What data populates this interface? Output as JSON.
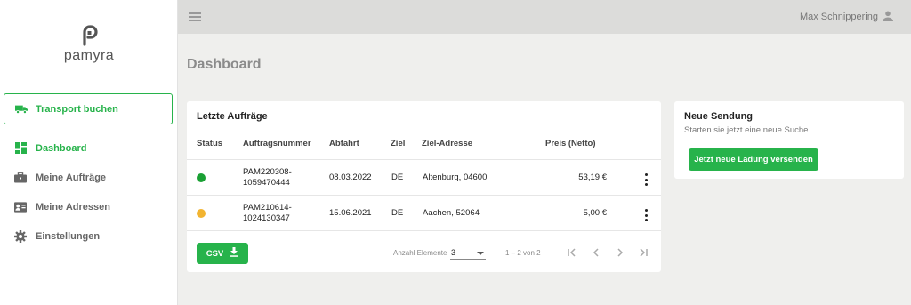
{
  "brand": {
    "name": "pamyra",
    "accent": "#27b34b"
  },
  "sidebar": {
    "book_button": {
      "label": "Transport buchen",
      "icon": "truck-icon"
    },
    "items": [
      {
        "label": "Dashboard",
        "icon": "dashboard-icon",
        "active": true
      },
      {
        "label": "Meine Aufträge",
        "icon": "briefcase-icon",
        "active": false
      },
      {
        "label": "Meine Adressen",
        "icon": "contact-card-icon",
        "active": false
      },
      {
        "label": "Einstellungen",
        "icon": "gear-icon",
        "active": false
      }
    ]
  },
  "topbar": {
    "user_name": "Max Schnippering",
    "menu_icon": "menu-icon",
    "user_icon": "user-icon"
  },
  "page_title": "Dashboard",
  "orders": {
    "title": "Letzte Aufträge",
    "columns": [
      "Status",
      "Auftragsnummer",
      "Abfahrt",
      "Ziel",
      "Ziel-Adresse",
      "Preis (Netto)"
    ],
    "rows": [
      {
        "status_color": "#1aa034",
        "order_line1": "PAM220308-",
        "order_line2": "1059470444",
        "departure": "08.03.2022",
        "dest": "DE",
        "address": "Altenburg, 04600",
        "price": "53,19 €"
      },
      {
        "status_color": "#f2b431",
        "order_line1": "PAM210614-",
        "order_line2": "1024130347",
        "departure": "15.06.2021",
        "dest": "DE",
        "address": "Aachen, 52064",
        "price": "5,00 €"
      }
    ],
    "csv_label": "CSV",
    "pagination": {
      "label": "Anzahl Elemente",
      "page_size": "3",
      "range": "1 – 2 von 2"
    }
  },
  "new_shipment": {
    "title": "Neue Sendung",
    "subtitle": "Starten sie jetzt eine neue Suche",
    "button": "Jetzt neue Ladung versenden"
  }
}
